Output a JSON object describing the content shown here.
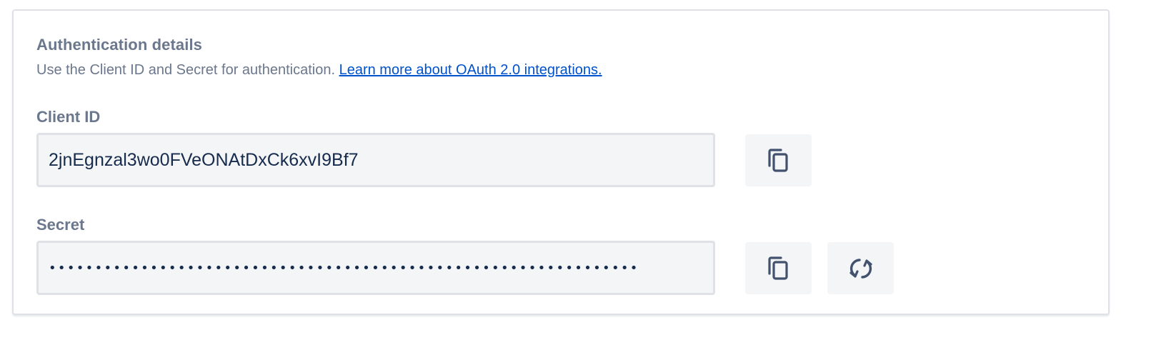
{
  "section": {
    "title": "Authentication details",
    "description": "Use the Client ID and Secret for authentication.",
    "learn_more_link": "Learn more about OAuth 2.0 integrations."
  },
  "client_id": {
    "label": "Client ID",
    "value": "2jnEgnzal3wo0FVeONAtDxCk6xvI9Bf7",
    "copy_icon": "copy-icon"
  },
  "secret": {
    "label": "Secret",
    "value": "••••••••••••••••••••••••••••••••••••••••••••••••••••••••••••••••",
    "copy_icon": "copy-icon",
    "regenerate_icon": "refresh-icon"
  },
  "colors": {
    "label_gray": "#6b778c",
    "link_blue": "#0052cc",
    "text_dark": "#172b4d",
    "field_bg": "#f4f5f7",
    "field_border": "#dfe1e6",
    "icon_dark": "#42526e"
  }
}
